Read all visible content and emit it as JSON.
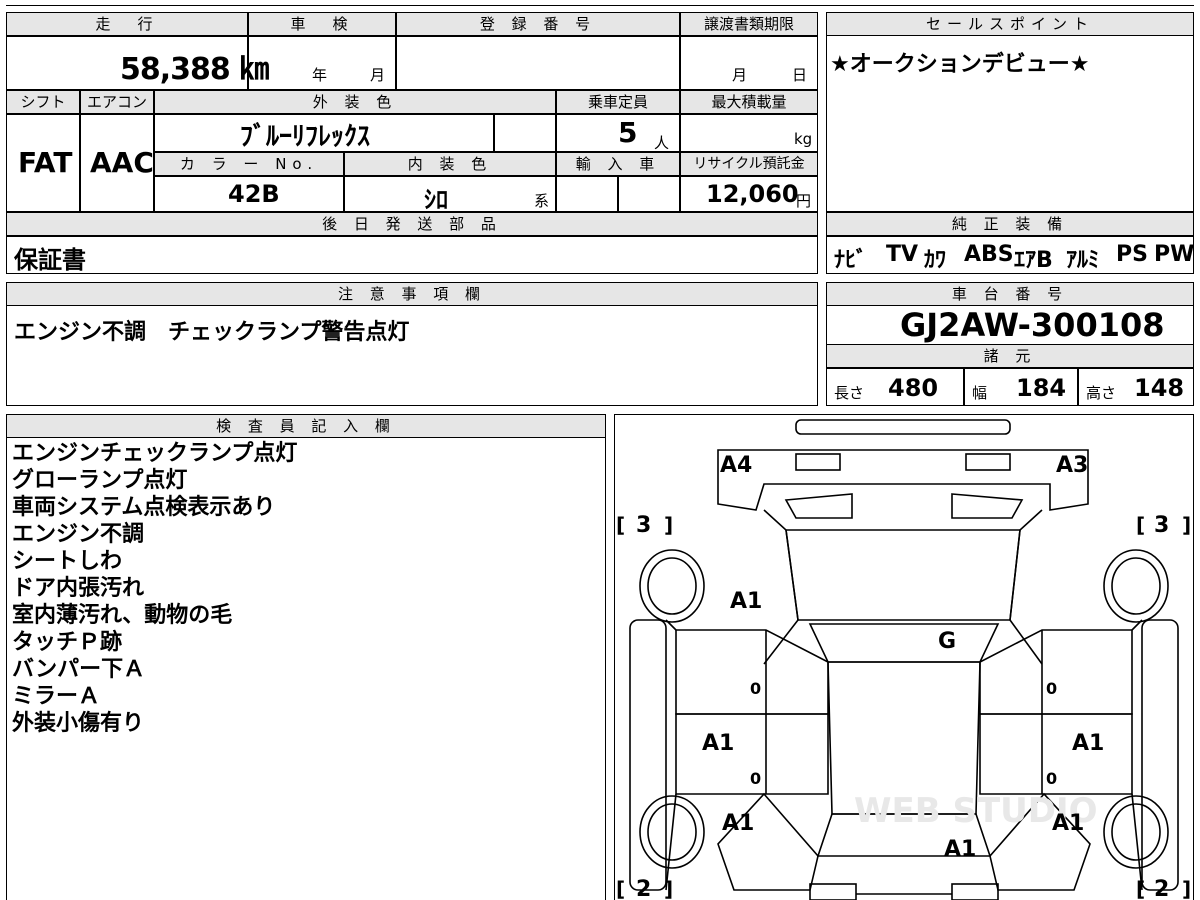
{
  "top_strip": {
    "partial_text": ""
  },
  "main_info": {
    "mileage_label": "走　行",
    "inspection_label": "車　検",
    "registration_label": "登 録 番 号",
    "transfer_label": "譲渡書類期限",
    "mileage_value": "58,388 ㎞",
    "inspection_year": "年",
    "inspection_month": "月",
    "transfer_month": "月",
    "transfer_day": "日",
    "shift_label": "シフト",
    "aircon_label": "エアコン",
    "exterior_label": "外 装 色",
    "capacity_label": "乗車定員",
    "max_load_label": "最大積載量",
    "shift_value": "FAT",
    "aircon_value": "AAC",
    "exterior_value": "ﾌﾞﾙｰﾘﾌﾚｯｸｽ",
    "capacity_value": "5",
    "capacity_unit": "人",
    "max_load_unit": "kg",
    "color_no_label": "カ ラ ー No.",
    "interior_label": "内 装 色",
    "import_label": "輸 入 車",
    "recycle_label": "リサイクル預託金",
    "color_no_value": "42B",
    "interior_value": "ｼﾛ",
    "interior_suffix": "系",
    "recycle_value": "12,060",
    "recycle_unit": "円",
    "later_parts_label": "後 日 発 送 部 品",
    "later_parts_value": "保証書"
  },
  "sales_point": {
    "label": "セールスポイント",
    "value": "★オークションデビュー★"
  },
  "genuine_equipment": {
    "label": "純 正 装 備",
    "items": [
      "ﾅﾋﾞ",
      "TV",
      "ｶﾜ",
      "ABS",
      "ｴｱB",
      "ｱﾙﾐ",
      "PS",
      "PW"
    ]
  },
  "caution": {
    "label": "注 意 事 項 欄",
    "value": "エンジン不調　チェックランプ警告点灯"
  },
  "chassis": {
    "label": "車 台 番 号",
    "value": "GJ2AW-300108",
    "specs_label": "諸 元",
    "length_label": "長さ",
    "length_value": "480",
    "width_label": "幅",
    "width_value": "184",
    "height_label": "高さ",
    "height_value": "148"
  },
  "inspector": {
    "label": "検 査 員 記 入 欄",
    "lines": [
      "エンジンチェックランプ点灯",
      "グローランプ点灯",
      "車両システム点検表示あり",
      "エンジン不調",
      "シートしわ",
      "ドア内張汚れ",
      "室内薄汚れ、動物の毛",
      "タッチＰ跡",
      "バンパー下Ａ",
      "ミラーＡ",
      "外装小傷有り"
    ]
  },
  "diagram": {
    "marks": {
      "front_left": "A4",
      "front_right": "A3",
      "bonnet": "A1",
      "roof": "G",
      "left_front_door": "A1",
      "right_front_door": "A1",
      "left_rear": "A1",
      "right_rear": "A1",
      "rear": "A1"
    },
    "tire_front_left": "3",
    "tire_front_right": "3",
    "tire_rear_left": "2",
    "tire_rear_right": "2",
    "bracket_open": "[",
    "bracket_close": "]",
    "zero": "0",
    "watermark": "WEB STUDIO"
  }
}
